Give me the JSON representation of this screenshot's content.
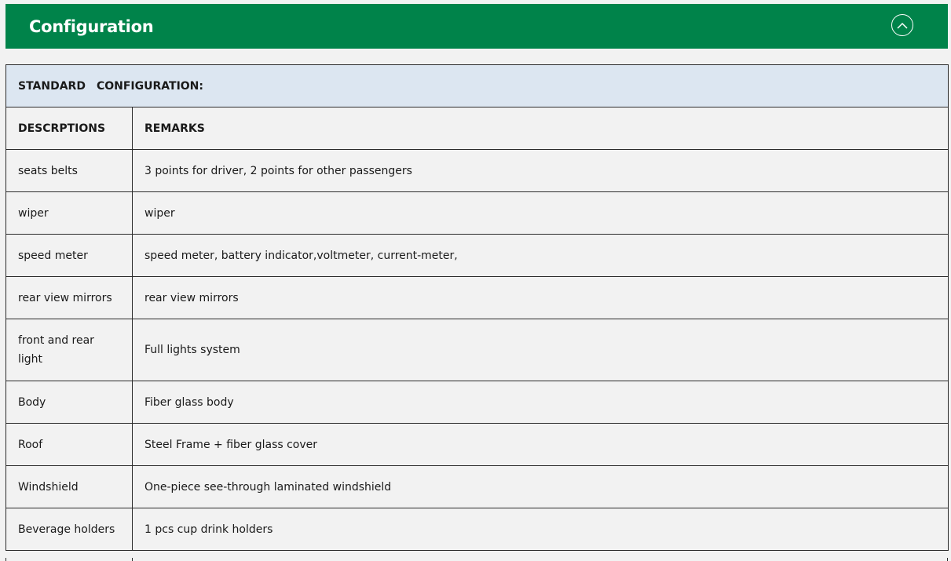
{
  "header": {
    "title": "Configuration",
    "collapse_icon": "chevron-up-icon",
    "background_color": "#00834a"
  },
  "table": {
    "section_title_part1": "STANDARD",
    "section_title_part2": "CONFIGURATION:",
    "section_background_color": "#dce6f1",
    "columns": [
      "DESCRPTIONS",
      "REMARKS"
    ],
    "rows": [
      {
        "description": "seats belts",
        "remarks": "3 points for driver, 2 points for other passengers"
      },
      {
        "description": "wiper",
        "remarks": "wiper"
      },
      {
        "description": "speed meter",
        "remarks": "speed meter, battery indicator,voltmeter, current-meter,"
      },
      {
        "description": "rear view mirrors",
        "remarks": "rear view mirrors"
      },
      {
        "description": "front and rear light",
        "remarks": "Full lights system"
      },
      {
        "description": "Body",
        "remarks": "Fiber glass body"
      },
      {
        "description": "Roof",
        "remarks": "Steel Frame + fiber glass cover"
      },
      {
        "description": "Windshield",
        "remarks": "One-piece see-through laminated windshield"
      },
      {
        "description": "Beverage holders",
        "remarks": "1 pcs cup drink holders"
      }
    ]
  }
}
